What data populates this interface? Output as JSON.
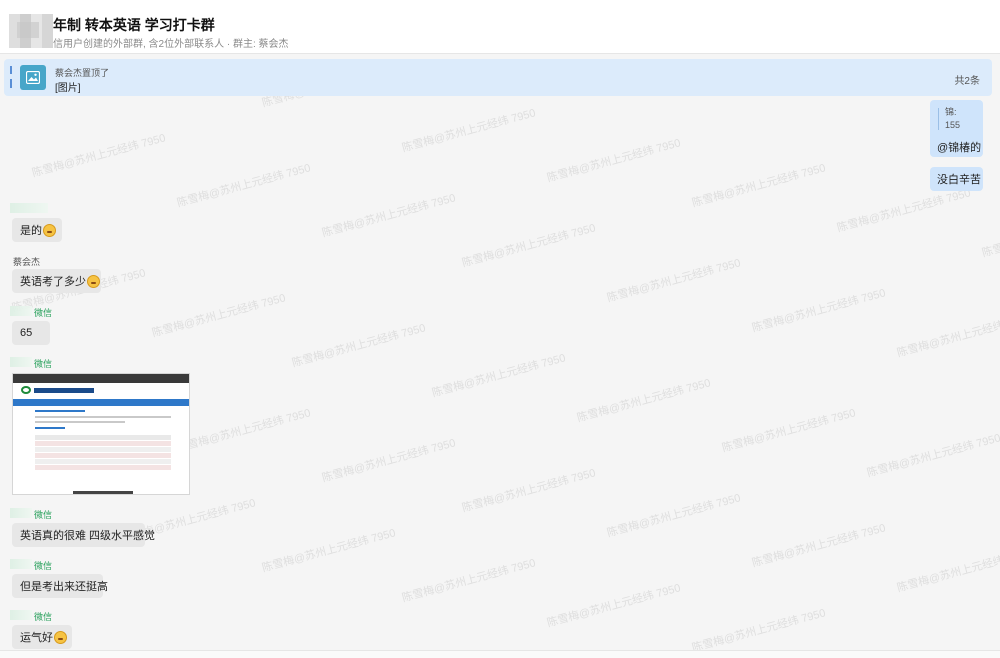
{
  "header": {
    "title": "年制 转本英语 学习打卡群",
    "subtitle": "信用户创建的外部群, 含2位外部联系人 · 群主: 蔡会杰"
  },
  "pinned": {
    "who": "蔡会杰置顶了",
    "message": "[图片]",
    "count": "共2条"
  },
  "messages": {
    "mine_quote_name": "锦:",
    "mine_quote_text": "155",
    "mine_1": "@锦椿的",
    "mine_2": "没白辛苦",
    "m1_text": "是的",
    "m2_sender": "蔡会杰",
    "m2_text": "英语考了多少",
    "m3_sender": "微信",
    "m3_text": "65",
    "m4_sender": "微信",
    "m5_sender": "微信",
    "m5_text": "英语真的很难 四级水平感觉",
    "m6_sender": "微信",
    "m6_text": "但是考出来还挺高",
    "m7_sender": "微信",
    "m7_text": "运气好"
  },
  "watermark": "陈雪梅@苏州上元经纬 7950",
  "colors": {
    "pinned_bg": "#dcebfb",
    "mine_bubble": "#cfe4fb",
    "other_bubble": "#e7e7e7",
    "wechat_green": "#26a05a"
  }
}
